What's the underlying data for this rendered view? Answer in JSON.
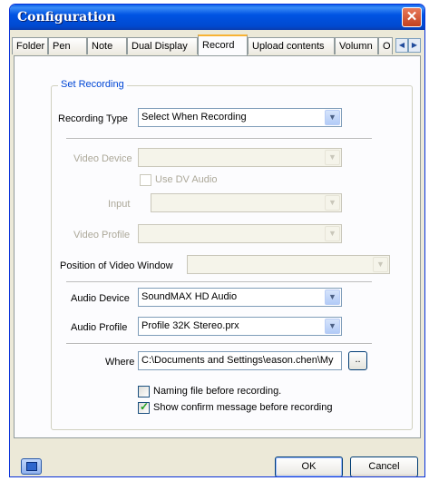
{
  "window": {
    "title": "Configuration",
    "close_glyph": "✕"
  },
  "tabs": [
    {
      "label": "Folder"
    },
    {
      "label": "Pen"
    },
    {
      "label": "Note"
    },
    {
      "label": "Dual Display"
    },
    {
      "label": "Record",
      "active": true
    },
    {
      "label": "Upload contents"
    },
    {
      "label": "Volumn"
    },
    {
      "label": "O"
    }
  ],
  "tab_scroll": {
    "left": "◀",
    "right": "▶"
  },
  "group": {
    "title": "Set Recording"
  },
  "recording_type": {
    "label": "Recording Type",
    "value": "Select When Recording"
  },
  "video_device": {
    "label": "Video Device",
    "value": ""
  },
  "use_dv_audio": {
    "label": "Use DV Audio",
    "checked": false
  },
  "input": {
    "label": "Input",
    "value": ""
  },
  "video_profile": {
    "label": "Video Profile",
    "value": ""
  },
  "video_window_position": {
    "label": "Position of Video Window",
    "value": ""
  },
  "audio_device": {
    "label": "Audio Device",
    "value": "SoundMAX HD Audio"
  },
  "audio_profile": {
    "label": "Audio Profile",
    "value": "Profile 32K Stereo.prx"
  },
  "where": {
    "label": "Where",
    "value": "C:\\Documents and Settings\\eason.chen\\My",
    "browse_label": ".."
  },
  "naming_file": {
    "label": "Naming file before recording.",
    "checked": false
  },
  "show_confirm": {
    "label": "Show confirm message before recording",
    "checked": true
  },
  "combo_arrow_glyph": "▼",
  "check_glyph": "✓",
  "buttons": {
    "ok": "OK",
    "cancel": "Cancel"
  },
  "icons": {
    "help": "monitor-icon"
  },
  "colors": {
    "titlebar": "#0054e3",
    "legend": "#0046d5",
    "active_tab_accent": "#f7b234",
    "checkmark": "#21a121"
  }
}
